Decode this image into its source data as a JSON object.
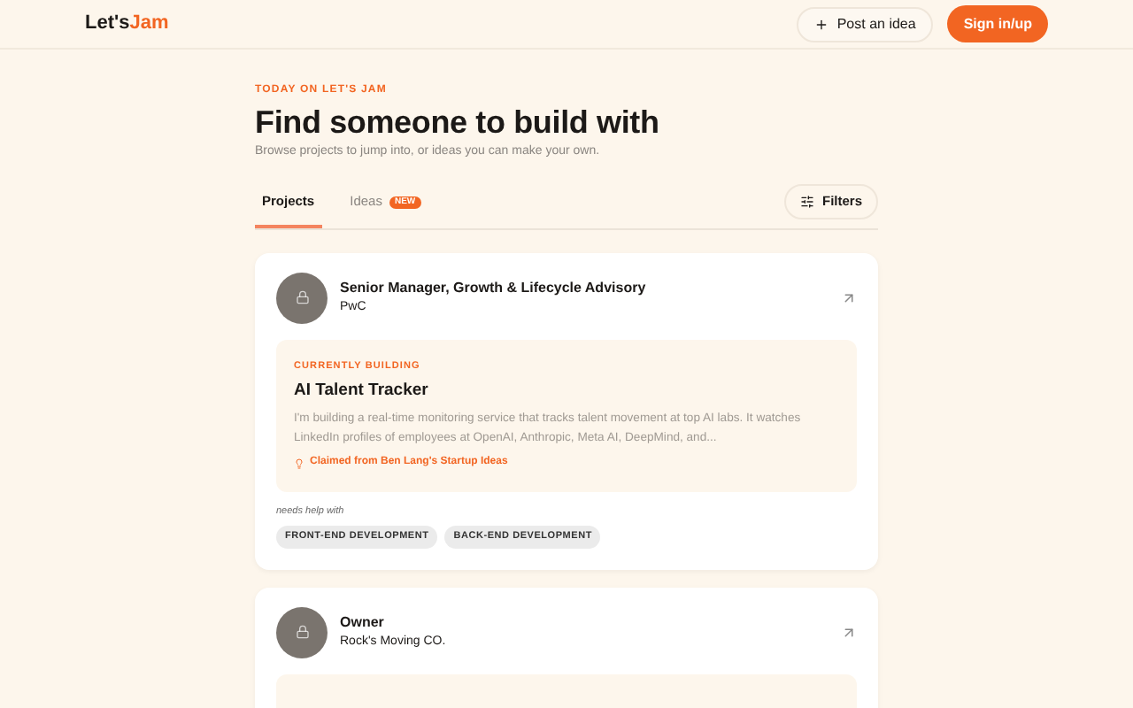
{
  "header": {
    "logo_part_1": "Let's",
    "logo_part_2": "Jam",
    "post_button": "Post an idea",
    "sign_in_button": "Sign in/up"
  },
  "eyebrow": "TODAY ON LET'S JAM",
  "title": "Find someone to build with",
  "subtitle": "Browse projects to jump into, or ideas you can make your own.",
  "tabs": [
    {
      "label": "Projects",
      "selected": true
    },
    {
      "label": "Ideas",
      "selected": false,
      "badge": "NEW"
    }
  ],
  "filters_button": "Filters",
  "cards": [
    {
      "role": "Senior Manager, Growth & Lifecycle Advisory",
      "company": "PwC",
      "project": {
        "label": "CURRENTLY BUILDING",
        "name": "AI Talent Tracker",
        "description": "I'm building a real-time monitoring service that tracks talent movement at top AI labs. It watches LinkedIn profiles of employees at OpenAI, Anthropic, Meta AI, DeepMind, and...",
        "source": "Claimed from Ben Lang's Startup Ideas"
      },
      "needs_label": "needs help with",
      "tags": [
        "FRONT-END DEVELOPMENT",
        "BACK-END DEVELOPMENT"
      ]
    },
    {
      "role": "Owner",
      "company": "Rock's Moving CO."
    }
  ]
}
